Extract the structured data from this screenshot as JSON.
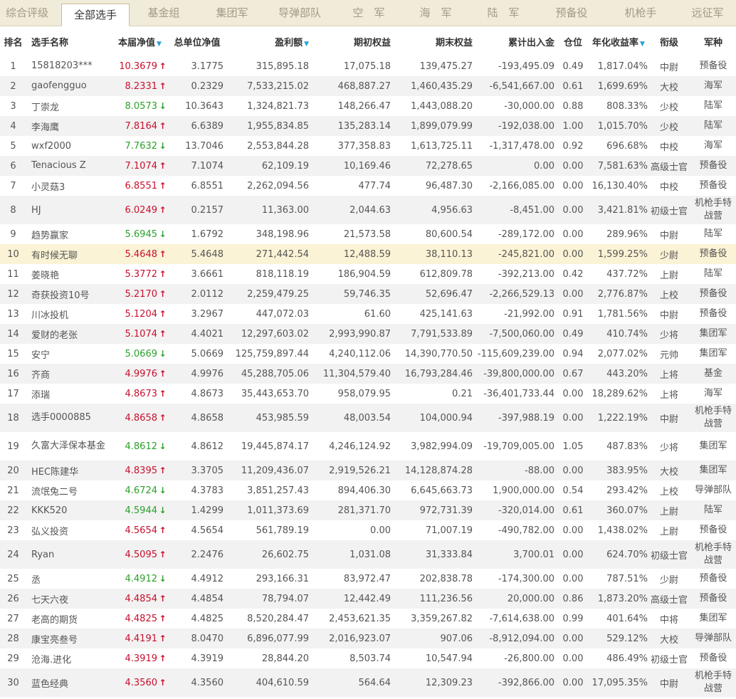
{
  "tabs": [
    {
      "label": "综合评级",
      "active": false
    },
    {
      "label": "全部选手",
      "active": true
    },
    {
      "label": "基金组",
      "active": false
    },
    {
      "label": "集团军",
      "active": false
    },
    {
      "label": "导弹部队",
      "active": false
    },
    {
      "label": "空　军",
      "active": false
    },
    {
      "label": "海　军",
      "active": false
    },
    {
      "label": "陆　军",
      "active": false
    },
    {
      "label": "预备役",
      "active": false
    },
    {
      "label": "机枪手",
      "active": false
    },
    {
      "label": "远征军",
      "active": false
    }
  ],
  "columns": [
    {
      "label": "排名",
      "sort": false
    },
    {
      "label": "选手名称",
      "sort": false
    },
    {
      "label": "本届净值",
      "sort": true
    },
    {
      "label": "总单位净值",
      "sort": false
    },
    {
      "label": "盈利额",
      "sort": true
    },
    {
      "label": "期初权益",
      "sort": false
    },
    {
      "label": "期末权益",
      "sort": false
    },
    {
      "label": "累计出入金",
      "sort": false
    },
    {
      "label": "仓位",
      "sort": false
    },
    {
      "label": "年化收益率",
      "sort": true
    },
    {
      "label": "衔级",
      "sort": false
    },
    {
      "label": "军种",
      "sort": false
    }
  ],
  "colors": {
    "up": "#c8102e",
    "down": "#2ba02b",
    "highlight": "#fbf3d5"
  },
  "rows": [
    {
      "rank": "1",
      "name": "15818203***",
      "nav": "10.3679",
      "dir": "up",
      "unit_nav": "3.1775",
      "profit": "315,895.18",
      "start": "17,075.18",
      "end": "139,475.27",
      "flow": "-193,495.09",
      "pos": "0.49",
      "annual": "1,817.04%",
      "title": "中尉",
      "army": "预备役"
    },
    {
      "rank": "2",
      "name": "gaofengguo",
      "nav": "8.2331",
      "dir": "up",
      "unit_nav": "0.2329",
      "profit": "7,533,215.02",
      "start": "468,887.27",
      "end": "1,460,435.29",
      "flow": "-6,541,667.00",
      "pos": "0.61",
      "annual": "1,699.69%",
      "title": "大校",
      "army": "海军"
    },
    {
      "rank": "3",
      "name": "丁崇龙",
      "nav": "8.0573",
      "dir": "down",
      "unit_nav": "10.3643",
      "profit": "1,324,821.73",
      "start": "148,266.47",
      "end": "1,443,088.20",
      "flow": "-30,000.00",
      "pos": "0.88",
      "annual": "808.33%",
      "title": "少校",
      "army": "陆军"
    },
    {
      "rank": "4",
      "name": "李海鹰",
      "nav": "7.8164",
      "dir": "up",
      "unit_nav": "6.6389",
      "profit": "1,955,834.85",
      "start": "135,283.14",
      "end": "1,899,079.99",
      "flow": "-192,038.00",
      "pos": "1.00",
      "annual": "1,015.70%",
      "title": "少校",
      "army": "陆军"
    },
    {
      "rank": "5",
      "name": "wxf2000",
      "nav": "7.7632",
      "dir": "down",
      "unit_nav": "13.7046",
      "profit": "2,553,844.28",
      "start": "377,358.83",
      "end": "1,613,725.11",
      "flow": "-1,317,478.00",
      "pos": "0.92",
      "annual": "696.68%",
      "title": "中校",
      "army": "海军"
    },
    {
      "rank": "6",
      "name": "Tenacious Z",
      "nav": "7.1074",
      "dir": "up",
      "unit_nav": "7.1074",
      "profit": "62,109.19",
      "start": "10,169.46",
      "end": "72,278.65",
      "flow": "0.00",
      "pos": "0.00",
      "annual": "7,581.63%",
      "title": "高级士官",
      "army": "预备役"
    },
    {
      "rank": "7",
      "name": "小灵菇3",
      "nav": "6.8551",
      "dir": "up",
      "unit_nav": "6.8551",
      "profit": "2,262,094.56",
      "start": "477.74",
      "end": "96,487.30",
      "flow": "-2,166,085.00",
      "pos": "0.00",
      "annual": "16,130.40%",
      "title": "中校",
      "army": "预备役"
    },
    {
      "rank": "8",
      "name": "HJ",
      "nav": "6.0249",
      "dir": "up",
      "unit_nav": "0.2157",
      "profit": "11,363.00",
      "start": "2,044.63",
      "end": "4,956.63",
      "flow": "-8,451.00",
      "pos": "0.00",
      "annual": "3,421.81%",
      "title": "初级士官",
      "army": "机枪手特战营"
    },
    {
      "rank": "9",
      "name": "趋势赢家",
      "nav": "5.6945",
      "dir": "down",
      "unit_nav": "1.6792",
      "profit": "348,198.96",
      "start": "21,573.58",
      "end": "80,600.54",
      "flow": "-289,172.00",
      "pos": "0.00",
      "annual": "289.96%",
      "title": "中尉",
      "army": "陆军"
    },
    {
      "rank": "10",
      "name": "有时候无聊",
      "nav": "5.4648",
      "dir": "up",
      "unit_nav": "5.4648",
      "profit": "271,442.54",
      "start": "12,488.59",
      "end": "38,110.13",
      "flow": "-245,821.00",
      "pos": "0.00",
      "annual": "1,599.25%",
      "title": "少尉",
      "army": "预备役",
      "highlight": true
    },
    {
      "rank": "11",
      "name": "姜晓艳",
      "nav": "5.3772",
      "dir": "up",
      "unit_nav": "3.6661",
      "profit": "818,118.19",
      "start": "186,904.59",
      "end": "612,809.78",
      "flow": "-392,213.00",
      "pos": "0.42",
      "annual": "437.72%",
      "title": "上尉",
      "army": "陆军"
    },
    {
      "rank": "12",
      "name": "奇获投资10号",
      "nav": "5.2170",
      "dir": "up",
      "unit_nav": "2.0112",
      "profit": "2,259,479.25",
      "start": "59,746.35",
      "end": "52,696.47",
      "flow": "-2,266,529.13",
      "pos": "0.00",
      "annual": "2,776.87%",
      "title": "上校",
      "army": "预备役"
    },
    {
      "rank": "13",
      "name": "川冰投机",
      "nav": "5.1204",
      "dir": "up",
      "unit_nav": "3.2967",
      "profit": "447,072.03",
      "start": "61.60",
      "end": "425,141.63",
      "flow": "-21,992.00",
      "pos": "0.91",
      "annual": "1,781.56%",
      "title": "中尉",
      "army": "预备役"
    },
    {
      "rank": "14",
      "name": "爱财的老张",
      "nav": "5.1074",
      "dir": "up",
      "unit_nav": "4.4021",
      "profit": "12,297,603.02",
      "start": "2,993,990.87",
      "end": "7,791,533.89",
      "flow": "-7,500,060.00",
      "pos": "0.49",
      "annual": "410.74%",
      "title": "少将",
      "army": "集团军"
    },
    {
      "rank": "15",
      "name": "安宁",
      "nav": "5.0669",
      "dir": "down",
      "unit_nav": "5.0669",
      "profit": "125,759,897.44",
      "start": "4,240,112.06",
      "end": "14,390,770.50",
      "flow": "-115,609,239.00",
      "pos": "0.94",
      "annual": "2,077.02%",
      "title": "元帅",
      "army": "集团军"
    },
    {
      "rank": "16",
      "name": "齐商",
      "nav": "4.9976",
      "dir": "up",
      "unit_nav": "4.9976",
      "profit": "45,288,705.06",
      "start": "11,304,579.40",
      "end": "16,793,284.46",
      "flow": "-39,800,000.00",
      "pos": "0.67",
      "annual": "443.20%",
      "title": "上将",
      "army": "基金"
    },
    {
      "rank": "17",
      "name": "添瑞",
      "nav": "4.8673",
      "dir": "up",
      "unit_nav": "4.8673",
      "profit": "35,443,653.70",
      "start": "958,079.95",
      "end": "0.21",
      "flow": "-36,401,733.44",
      "pos": "0.00",
      "annual": "18,289.62%",
      "title": "上将",
      "army": "海军"
    },
    {
      "rank": "18",
      "name": "选手0000885",
      "nav": "4.8658",
      "dir": "up",
      "unit_nav": "4.8658",
      "profit": "453,985.59",
      "start": "48,003.54",
      "end": "104,000.94",
      "flow": "-397,988.19",
      "pos": "0.00",
      "annual": "1,222.19%",
      "title": "中尉",
      "army": "机枪手特战营"
    },
    {
      "rank": "19",
      "name": "久富大泽保本基金",
      "nav": "4.8612",
      "dir": "down",
      "unit_nav": "4.8612",
      "profit": "19,445,874.17",
      "start": "4,246,124.92",
      "end": "3,982,994.09",
      "flow": "-19,709,005.00",
      "pos": "1.05",
      "annual": "487.83%",
      "title": "少将",
      "army": "集团军"
    },
    {
      "rank": "20",
      "name": "HEC陈建华",
      "nav": "4.8395",
      "dir": "up",
      "unit_nav": "3.3705",
      "profit": "11,209,436.07",
      "start": "2,919,526.21",
      "end": "14,128,874.28",
      "flow": "-88.00",
      "pos": "0.00",
      "annual": "383.95%",
      "title": "大校",
      "army": "集团军"
    },
    {
      "rank": "21",
      "name": "流氓兔二号",
      "nav": "4.6724",
      "dir": "down",
      "unit_nav": "4.3783",
      "profit": "3,851,257.43",
      "start": "894,406.30",
      "end": "6,645,663.73",
      "flow": "1,900,000.00",
      "pos": "0.54",
      "annual": "293.42%",
      "title": "上校",
      "army": "导弹部队"
    },
    {
      "rank": "22",
      "name": "KKK520",
      "nav": "4.5944",
      "dir": "down",
      "unit_nav": "1.4299",
      "profit": "1,011,373.69",
      "start": "281,371.70",
      "end": "972,731.39",
      "flow": "-320,014.00",
      "pos": "0.61",
      "annual": "360.07%",
      "title": "上尉",
      "army": "陆军"
    },
    {
      "rank": "23",
      "name": "弘义投资",
      "nav": "4.5654",
      "dir": "up",
      "unit_nav": "4.5654",
      "profit": "561,789.19",
      "start": "0.00",
      "end": "71,007.19",
      "flow": "-490,782.00",
      "pos": "0.00",
      "annual": "1,438.02%",
      "title": "上尉",
      "army": "预备役"
    },
    {
      "rank": "24",
      "name": "Ryan",
      "nav": "4.5095",
      "dir": "up",
      "unit_nav": "2.2476",
      "profit": "26,602.75",
      "start": "1,031.08",
      "end": "31,333.84",
      "flow": "3,700.01",
      "pos": "0.00",
      "annual": "624.70%",
      "title": "初级士官",
      "army": "机枪手特战营"
    },
    {
      "rank": "25",
      "name": "丞",
      "nav": "4.4912",
      "dir": "down",
      "unit_nav": "4.4912",
      "profit": "293,166.31",
      "start": "83,972.47",
      "end": "202,838.78",
      "flow": "-174,300.00",
      "pos": "0.00",
      "annual": "787.51%",
      "title": "少尉",
      "army": "预备役"
    },
    {
      "rank": "26",
      "name": "七天六夜",
      "nav": "4.4854",
      "dir": "up",
      "unit_nav": "4.4854",
      "profit": "78,794.07",
      "start": "12,442.49",
      "end": "111,236.56",
      "flow": "20,000.00",
      "pos": "0.86",
      "annual": "1,873.20%",
      "title": "高级士官",
      "army": "预备役"
    },
    {
      "rank": "27",
      "name": "老高的期货",
      "nav": "4.4825",
      "dir": "up",
      "unit_nav": "4.4825",
      "profit": "8,520,284.47",
      "start": "2,453,621.35",
      "end": "3,359,267.82",
      "flow": "-7,614,638.00",
      "pos": "0.99",
      "annual": "401.64%",
      "title": "中将",
      "army": "集团军"
    },
    {
      "rank": "28",
      "name": "康宝亮叁号",
      "nav": "4.4191",
      "dir": "up",
      "unit_nav": "8.0470",
      "profit": "6,896,077.99",
      "start": "2,016,923.07",
      "end": "907.06",
      "flow": "-8,912,094.00",
      "pos": "0.00",
      "annual": "529.12%",
      "title": "大校",
      "army": "导弹部队"
    },
    {
      "rank": "29",
      "name": "沧海.进化",
      "nav": "4.3919",
      "dir": "up",
      "unit_nav": "4.3919",
      "profit": "28,844.20",
      "start": "8,503.74",
      "end": "10,547.94",
      "flow": "-26,800.00",
      "pos": "0.00",
      "annual": "486.49%",
      "title": "初级士官",
      "army": "预备役"
    },
    {
      "rank": "30",
      "name": "蓝色经典",
      "nav": "4.3560",
      "dir": "up",
      "unit_nav": "4.3560",
      "profit": "404,610.59",
      "start": "564.64",
      "end": "12,309.23",
      "flow": "-392,866.00",
      "pos": "0.00",
      "annual": "17,095.35%",
      "title": "中尉",
      "army": "机枪手特战营"
    }
  ]
}
